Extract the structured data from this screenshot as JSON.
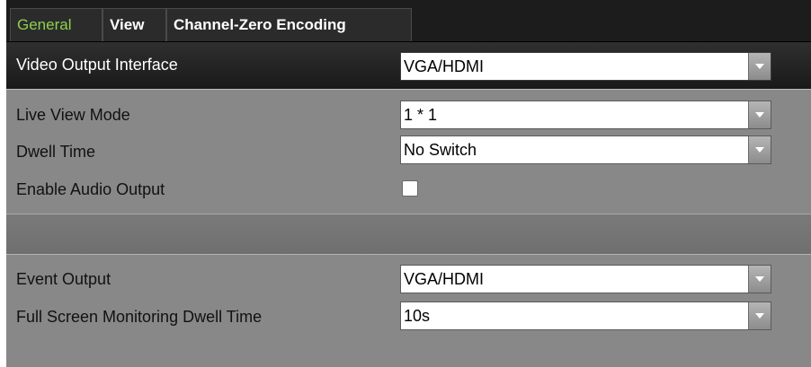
{
  "tabs": [
    {
      "label": "General",
      "active": true
    },
    {
      "label": "View",
      "active": false
    },
    {
      "label": "Channel-Zero Encoding",
      "active": false
    }
  ],
  "video_output": {
    "label": "Video Output Interface",
    "value": "VGA/HDMI"
  },
  "live_view_mode": {
    "label": "Live View Mode",
    "value": "1 * 1"
  },
  "dwell_time": {
    "label": "Dwell Time",
    "value": "No Switch"
  },
  "audio_output": {
    "label": "Enable Audio Output",
    "checked": false
  },
  "event_output": {
    "label": "Event Output",
    "value": "VGA/HDMI"
  },
  "full_screen_dwell": {
    "label": "Full Screen Monitoring Dwell Time",
    "value": "10s"
  },
  "icons": {
    "dropdown": "chevron-down-icon"
  },
  "colors": {
    "active_tab_text": "#8fd14f",
    "panel_bg": "#888888",
    "header_bg": "#1c1c1c"
  }
}
